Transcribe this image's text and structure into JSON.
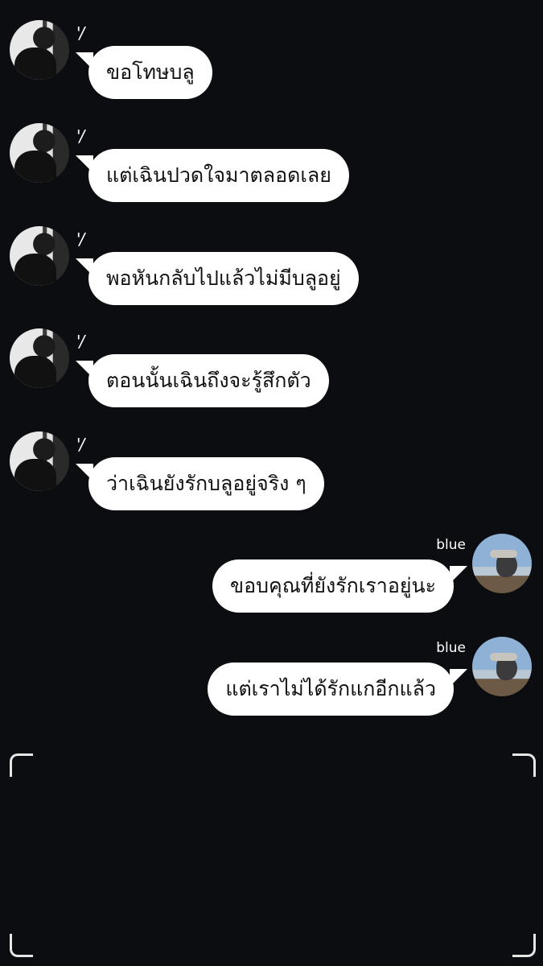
{
  "messages": [
    {
      "sender": "other",
      "name": "'/",
      "text": "ขอโทษบลู"
    },
    {
      "sender": "other",
      "name": "'/",
      "text": "แต่เฉินปวดใจมาตลอดเลย"
    },
    {
      "sender": "other",
      "name": "'/",
      "text": "พอหันกลับไปแล้วไม่มีบลูอยู่"
    },
    {
      "sender": "other",
      "name": "'/",
      "text": "ตอนนั้นเฉินถึงจะรู้สึกตัว"
    },
    {
      "sender": "other",
      "name": "'/",
      "text": "ว่าเฉินยังรักบลูอยู่จริง ๆ"
    },
    {
      "sender": "me",
      "name": "blue",
      "text": "ขอบคุณที่ยังรักเราอยู่นะ"
    },
    {
      "sender": "me",
      "name": "blue",
      "text": "แต่เราไม่ได้รักแกอีกแล้ว"
    }
  ],
  "colors": {
    "background": "#0b0d10",
    "bubble": "#ffffff",
    "text": "#111111",
    "name": "#ffffff"
  },
  "icons": {
    "left_avatar": "avatar-dark-portrait",
    "right_avatar": "avatar-sky-portrait",
    "frame": "viewfinder-corner-icons"
  }
}
